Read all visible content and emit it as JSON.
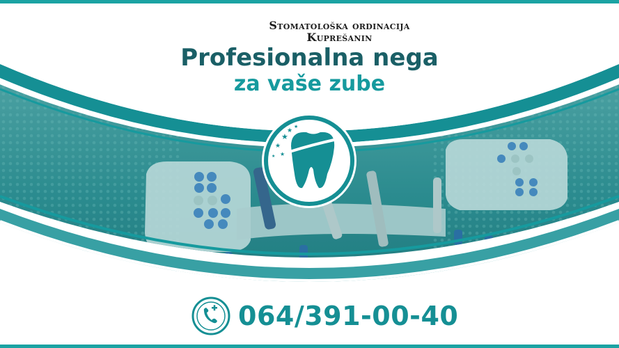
{
  "header": {
    "clinic_line1": "Stomatološka ordinacija",
    "clinic_line2": "Kuprešanin",
    "headline_line1": "Profesionalna nega",
    "headline_line2": "za vaše zube"
  },
  "contact": {
    "phone": "064/391-00-40",
    "phone_icon": "phone-medical-icon"
  },
  "logo": {
    "icon": "tooth-stars-icon"
  },
  "colors": {
    "brand_dark": "#1a5f66",
    "brand_teal": "#169a9e",
    "accent": "#1ba3a3"
  }
}
